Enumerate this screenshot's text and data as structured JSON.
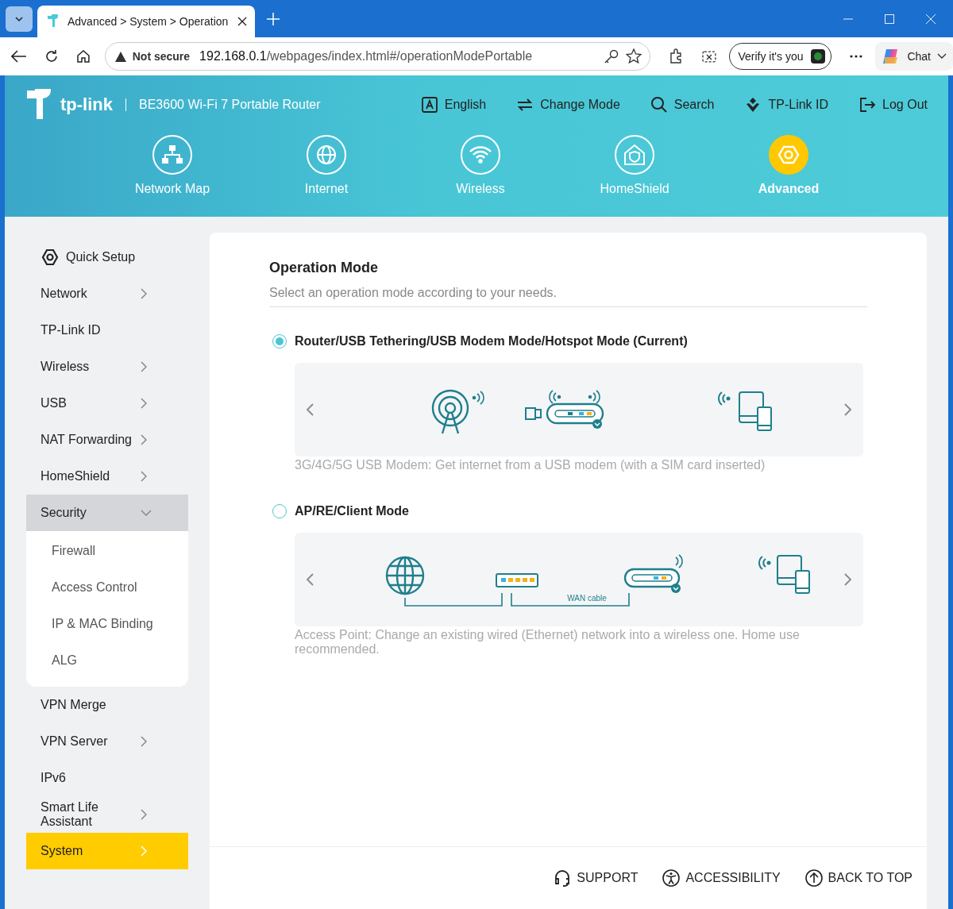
{
  "browser": {
    "tab_title": "Advanced > System > Operation",
    "security": "Not secure",
    "url_host": "192.168.0.1",
    "url_path": "/webpages/index.html#/operationModePortable",
    "verify": "Verify it's you",
    "chat": "Chat"
  },
  "header": {
    "brand": "tp-link",
    "model": "BE3600 Wi-Fi 7 Portable Router",
    "actions": [
      {
        "label": "English"
      },
      {
        "label": "Change Mode"
      },
      {
        "label": "Search"
      },
      {
        "label": "TP-Link ID"
      },
      {
        "label": "Log Out"
      }
    ],
    "nav": [
      {
        "label": "Network Map",
        "selected": false
      },
      {
        "label": "Internet",
        "selected": false
      },
      {
        "label": "Wireless",
        "selected": false
      },
      {
        "label": "HomeShield",
        "selected": false
      },
      {
        "label": "Advanced",
        "selected": true
      }
    ]
  },
  "sidebar": {
    "items": [
      {
        "label": "Quick Setup",
        "kind": "quick",
        "expandable": false,
        "expanded": false,
        "selected": false
      },
      {
        "label": "Network",
        "kind": "item",
        "expandable": true,
        "expanded": false,
        "selected": false
      },
      {
        "label": "TP-Link ID",
        "kind": "item",
        "expandable": false,
        "expanded": false,
        "selected": false
      },
      {
        "label": "Wireless",
        "kind": "item",
        "expandable": true,
        "expanded": false,
        "selected": false
      },
      {
        "label": "USB",
        "kind": "item",
        "expandable": true,
        "expanded": false,
        "selected": false
      },
      {
        "label": "NAT Forwarding",
        "kind": "item",
        "expandable": true,
        "expanded": false,
        "selected": false
      },
      {
        "label": "HomeShield",
        "kind": "item",
        "expandable": true,
        "expanded": false,
        "selected": false
      },
      {
        "label": "Security",
        "kind": "item",
        "expandable": true,
        "expanded": true,
        "selected": false,
        "children": [
          {
            "label": "Firewall"
          },
          {
            "label": "Access Control"
          },
          {
            "label": "IP & MAC Binding"
          },
          {
            "label": "ALG"
          }
        ]
      },
      {
        "label": "VPN Merge",
        "kind": "item",
        "expandable": false,
        "expanded": false,
        "selected": false
      },
      {
        "label": "VPN Server",
        "kind": "item",
        "expandable": true,
        "expanded": false,
        "selected": false
      },
      {
        "label": "IPv6",
        "kind": "item",
        "expandable": false,
        "expanded": false,
        "selected": false
      },
      {
        "label": "Smart Life Assistant",
        "kind": "item",
        "expandable": true,
        "expanded": false,
        "selected": false
      },
      {
        "label": "System",
        "kind": "item",
        "expandable": true,
        "expanded": false,
        "selected": true
      }
    ]
  },
  "content": {
    "title": "Operation Mode",
    "subtitle": "Select an operation mode according to your needs.",
    "modes": [
      {
        "label": "Router/USB Tethering/USB Modem Mode/Hotspot Mode (Current)",
        "selected": true,
        "kind": "usb",
        "description": "3G/4G/5G USB Modem: Get internet from a USB modem (with a SIM card inserted)"
      },
      {
        "label": "AP/RE/Client Mode",
        "selected": false,
        "kind": "ap",
        "diagram_label": "WAN cable",
        "description": "Access Point: Change an existing wired (Ethernet) network into a wireless one. Home use recommended."
      }
    ]
  },
  "footer": [
    {
      "label": "SUPPORT"
    },
    {
      "label": "ACCESSIBILITY"
    },
    {
      "label": "BACK TO TOP"
    }
  ]
}
